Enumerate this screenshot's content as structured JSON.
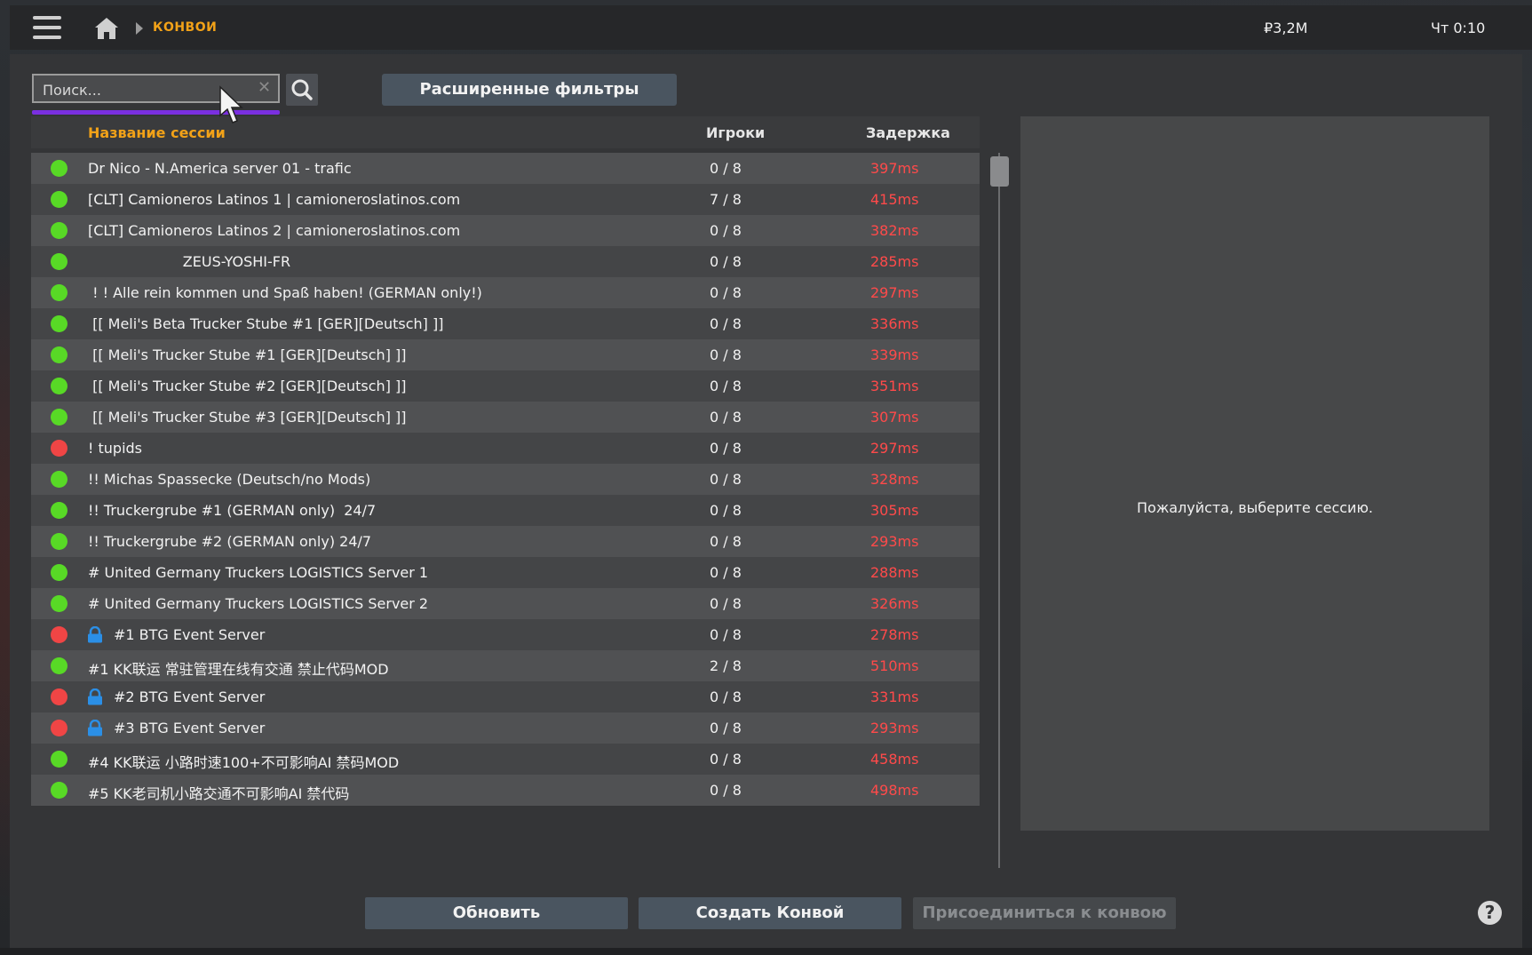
{
  "topbar": {
    "breadcrumb": "КОНВОИ",
    "money": "₽3,2M",
    "clock": "Чт 0:10"
  },
  "search": {
    "placeholder": "Поиск...",
    "value": "",
    "clear_glyph": "✕"
  },
  "filters_button": "Расширенные фильтры",
  "table": {
    "columns": {
      "name": "Название сессии",
      "players": "Игроки",
      "latency": "Задержка"
    },
    "rows": [
      {
        "status": "online",
        "locked": false,
        "name": "Dr Nico - N.America server 01 - trafic",
        "players": "0 / 8",
        "latency": "397ms"
      },
      {
        "status": "online",
        "locked": false,
        "name": "[CLT] Camioneros Latinos 1 | camioneroslatinos.com",
        "players": "7 / 8",
        "latency": "415ms"
      },
      {
        "status": "online",
        "locked": false,
        "name": "[CLT] Camioneros Latinos 2 | camioneroslatinos.com",
        "players": "0 / 8",
        "latency": "382ms"
      },
      {
        "status": "online",
        "locked": false,
        "name": "                     ZEUS-YOSHI-FR",
        "players": "0 / 8",
        "latency": "285ms"
      },
      {
        "status": "online",
        "locked": false,
        "name": " ! ! Alle rein kommen und Spaß haben! (GERMAN only!)",
        "players": "0 / 8",
        "latency": "297ms"
      },
      {
        "status": "online",
        "locked": false,
        "name": " [[ Meli's Beta Trucker Stube #1 [GER][Deutsch] ]]",
        "players": "0 / 8",
        "latency": "336ms"
      },
      {
        "status": "online",
        "locked": false,
        "name": " [[ Meli's Trucker Stube #1 [GER][Deutsch] ]]",
        "players": "0 / 8",
        "latency": "339ms"
      },
      {
        "status": "online",
        "locked": false,
        "name": " [[ Meli's Trucker Stube #2 [GER][Deutsch] ]]",
        "players": "0 / 8",
        "latency": "351ms"
      },
      {
        "status": "online",
        "locked": false,
        "name": " [[ Meli's Trucker Stube #3 [GER][Deutsch] ]]",
        "players": "0 / 8",
        "latency": "307ms"
      },
      {
        "status": "offline",
        "locked": false,
        "name": "! tupids",
        "players": "0 / 8",
        "latency": "297ms"
      },
      {
        "status": "online",
        "locked": false,
        "name": "!! Michas Spassecke (Deutsch/no Mods)",
        "players": "0 / 8",
        "latency": "328ms"
      },
      {
        "status": "online",
        "locked": false,
        "name": "!! Truckergrube #1 (GERMAN only)  24/7",
        "players": "0 / 8",
        "latency": "305ms"
      },
      {
        "status": "online",
        "locked": false,
        "name": "!! Truckergrube #2 (GERMAN only) 24/7",
        "players": "0 / 8",
        "latency": "293ms"
      },
      {
        "status": "online",
        "locked": false,
        "name": "# United Germany Truckers LOGISTICS Server 1",
        "players": "0 / 8",
        "latency": "288ms"
      },
      {
        "status": "online",
        "locked": false,
        "name": "# United Germany Truckers LOGISTICS Server 2",
        "players": "0 / 8",
        "latency": "326ms"
      },
      {
        "status": "offline",
        "locked": true,
        "name": "#1 BTG Event Server",
        "players": "0 / 8",
        "latency": "278ms"
      },
      {
        "status": "online",
        "locked": false,
        "name": "#1 KK联运 常驻管理在线有交通 禁止代码MOD",
        "players": "2 / 8",
        "latency": "510ms"
      },
      {
        "status": "offline",
        "locked": true,
        "name": "#2 BTG Event Server",
        "players": "0 / 8",
        "latency": "331ms"
      },
      {
        "status": "offline",
        "locked": true,
        "name": "#3 BTG Event Server",
        "players": "0 / 8",
        "latency": "293ms"
      },
      {
        "status": "online",
        "locked": false,
        "name": "#4 KK联运 小路时速100+不可影响AI 禁码MOD",
        "players": "0 / 8",
        "latency": "458ms"
      },
      {
        "status": "online",
        "locked": false,
        "name": "#5 KK老司机小路交通不可影响AI 禁代码",
        "players": "0 / 8",
        "latency": "498ms"
      }
    ]
  },
  "detail": {
    "message": "Пожалуйста, выберите сессию."
  },
  "buttons": {
    "refresh": "Обновить",
    "create": "Создать Конвой",
    "join": "Присоединиться к конвою",
    "help": "?"
  },
  "colors": {
    "accent": "#f2a218",
    "online": "#58d926",
    "offline": "#f04545",
    "latency": "#ff4a4a",
    "search_underline": "#7a2fe0",
    "lock": "#2b8fe6"
  },
  "icons": [
    "menu-icon",
    "home-icon",
    "chevron-right-icon",
    "search-icon",
    "close-icon",
    "lock-icon",
    "help-icon"
  ]
}
